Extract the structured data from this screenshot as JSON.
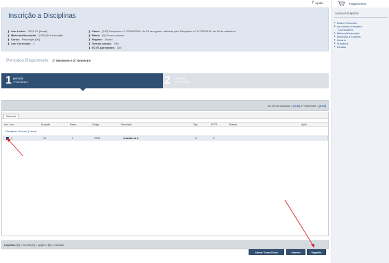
{
  "help": {
    "label": "Ajuda"
  },
  "sidebar": {
    "cart_label": "Pagamentos",
    "quick_access_title": "Acessos Rápidos",
    "links": [
      {
        "label": "Dados Pessoais",
        "sub": false
      },
      {
        "label": "As minhas Unidades",
        "sub": false
      },
      {
        "label": "Curriculares",
        "sub": true
      },
      {
        "label": "Matrícula/Inscrição",
        "sub": false
      },
      {
        "label": "Inscrição a Exames",
        "sub": false
      },
      {
        "label": "Horário",
        "sub": false
      },
      {
        "label": "Sumários",
        "sub": false
      },
      {
        "label": "Dívidas",
        "sub": false
      }
    ]
  },
  "header": {
    "title": "Inscrição a Disciplinas",
    "left_info": [
      {
        "label": "Ano Letivo:",
        "value": "2022-23 [Anual]"
      },
      {
        "label": "Matrícula/Inscrição:",
        "value": "[1000] Pré-inscrição"
      },
      {
        "label": "Curso:",
        "value": "Psicologia [06]"
      },
      {
        "label": "Ano Curricular:",
        "value": "3"
      }
    ],
    "right_info": [
      {
        "label": "Plano:",
        "value": "[103] Despacho n.º 22326/2009, de 28 de agosto, alterado pelo Despacho n.º 11750/2014, de 16 de setembro"
      },
      {
        "label": "Ramo:",
        "value": "[0] Tronco comum"
      },
      {
        "label": "Regime:",
        "value": "Diurno"
      },
      {
        "label": "Turmas únicas:",
        "value": "SIM"
      },
      {
        "label": "ECTS Aprovados:",
        "value": "145"
      }
    ]
  },
  "periods": {
    "title": "Períodos Disponíveis:",
    "selected": "1º Semestre e 2º Semestre",
    "steps": [
      {
        "number": "1",
        "title": "período",
        "subtitle": "1º Semestre"
      },
      {
        "number": "2",
        "title": "período",
        "subtitle": "2º Semestre"
      }
    ]
  },
  "ects": {
    "prefix": "ECTS de inscrição = [",
    "total": "5.00",
    "mid": "]   1º Semestre = [",
    "semester": "5.00",
    "suffix": "]"
  },
  "table": {
    "tab_label": "Semestre",
    "columns": [
      "Ano Curr.",
      "Duração",
      "Ramo",
      "Código",
      "Descrição",
      "Tipo",
      "ECTS",
      "Estado",
      "Ação"
    ],
    "group_label": "- Disciplinas: Normais [1 linha]",
    "rows": [
      {
        "checked": true,
        "ano": "3",
        "duracao": "S1",
        "ramo": "0",
        "codigo": "73991",
        "descricao": "■ ■■■■■ ■■ ■",
        "tipo": "N",
        "ects": "5",
        "estado": "",
        "acao": ""
      }
    ]
  },
  "legend": {
    "label": "Legenda:",
    "text": "[N] = normal  [O] = opção e [M] = modular"
  },
  "buttons": {
    "alterar": "Alterar Turma Única",
    "anterior": "Anterior",
    "seguinte": "Seguinte"
  }
}
